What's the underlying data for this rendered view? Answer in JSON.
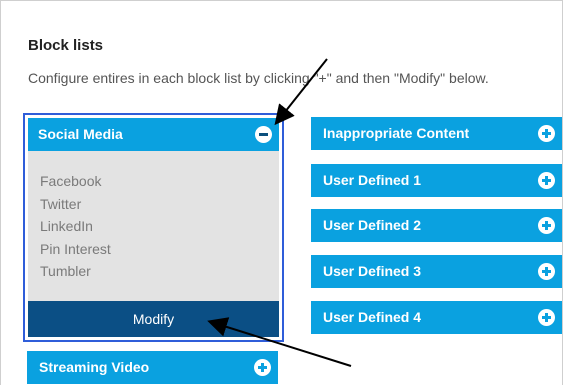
{
  "page": {
    "title": "Block lists",
    "description": "Configure entires in each block list by clicking \"+\" and then \"Modify\" below."
  },
  "social_media": {
    "label": "Social Media",
    "items": [
      "Facebook",
      "Twitter",
      "LinkedIn",
      "Pin Interest",
      "Tumbler"
    ],
    "modify_label": "Modify",
    "expanded": true
  },
  "lists": [
    {
      "label": "Inappropriate Content"
    },
    {
      "label": "User Defined 1"
    },
    {
      "label": "User Defined 2"
    },
    {
      "label": "User Defined 3"
    },
    {
      "label": "User Defined 4"
    }
  ],
  "streaming": {
    "label": "Streaming Video"
  },
  "icons": {
    "expand": "plus-circle-icon",
    "collapse": "minus-circle-icon"
  },
  "colors": {
    "accent": "#0aa1e0",
    "dark": "#0b4f85",
    "highlight_border": "#2f5dd9",
    "panel_bg": "#e3e3e3"
  }
}
